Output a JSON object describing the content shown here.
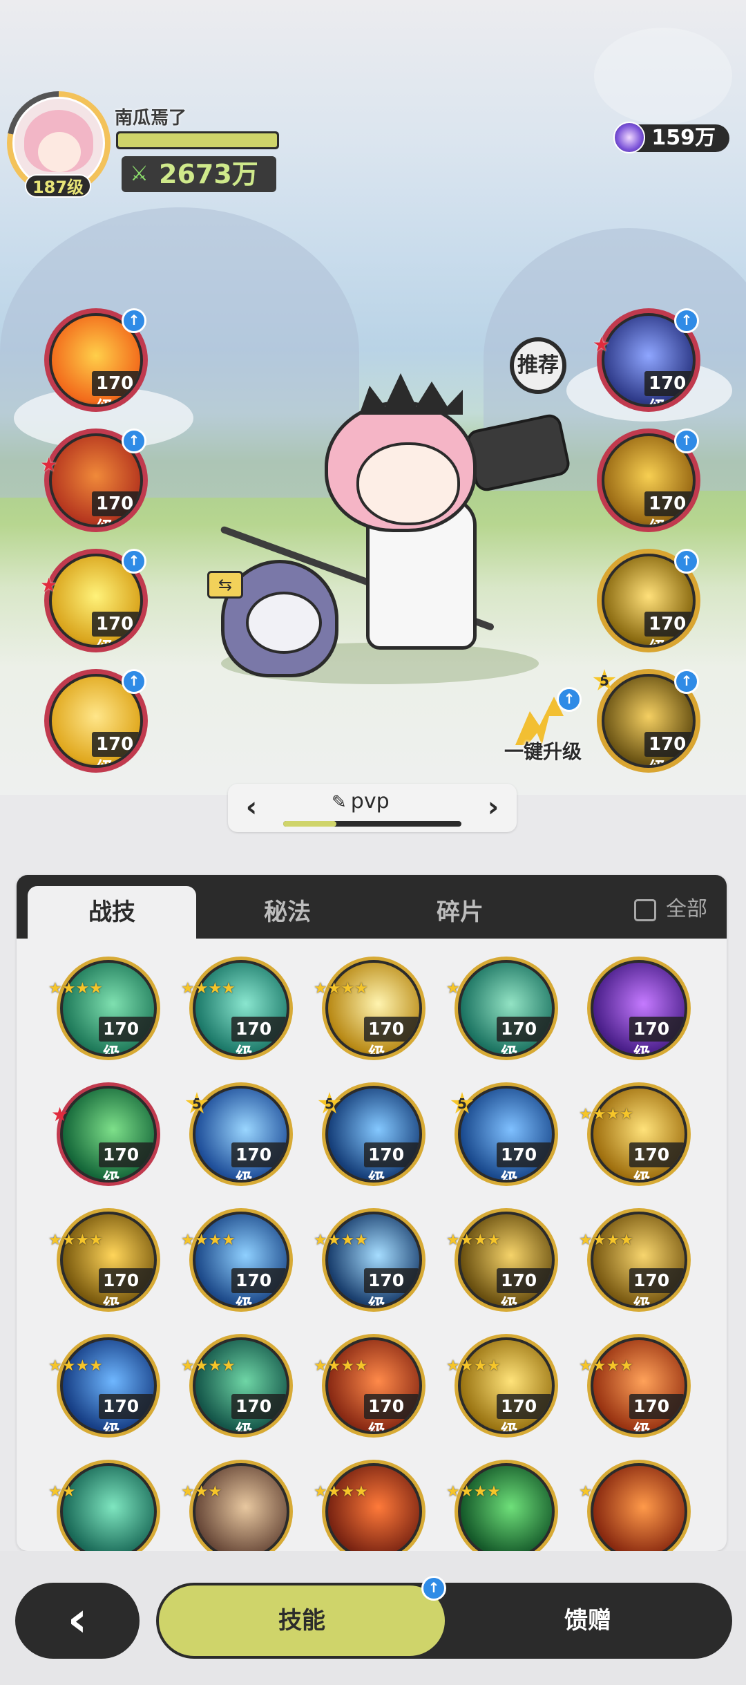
{
  "player": {
    "name": "南瓜焉了",
    "level": "187级",
    "power": "2673万",
    "currency": "159万"
  },
  "left_slots": [
    {
      "level": "170级",
      "colors": [
        "#f26a1b",
        "#ffcf4a"
      ],
      "ring": "red",
      "red_star": false
    },
    {
      "level": "170级",
      "colors": [
        "#b6371f",
        "#f08a3a"
      ],
      "ring": "red",
      "red_star": true
    },
    {
      "level": "170级",
      "colors": [
        "#d9a41c",
        "#fff27a"
      ],
      "ring": "red",
      "red_star": true
    },
    {
      "level": "170级",
      "colors": [
        "#e0a81e",
        "#ffe68a"
      ],
      "ring": "red",
      "red_star": false
    }
  ],
  "right_slots": [
    {
      "level": "170级",
      "colors": [
        "#2f3b8a",
        "#8fa6ff"
      ],
      "ring": "red",
      "red_star": true
    },
    {
      "level": "170级",
      "colors": [
        "#9a6a14",
        "#f7cf52"
      ],
      "ring": "red",
      "red_star": false
    },
    {
      "level": "170级",
      "colors": [
        "#8a6a10",
        "#ffe07a"
      ],
      "ring": "gold",
      "red_star": false
    },
    {
      "level": "170级",
      "colors": [
        "#6b5414",
        "#f4cf62"
      ],
      "ring": "gold",
      "red_star": false
    }
  ],
  "recommend_label": "推荐",
  "one_key_upgrade": {
    "label": "一键升级",
    "badge": "5"
  },
  "preset": {
    "label": "pvp",
    "progress": 0.3
  },
  "panel": {
    "tabs": [
      {
        "label": "战技",
        "active": true
      },
      {
        "label": "秘法",
        "active": false
      },
      {
        "label": "碎片",
        "active": false
      }
    ],
    "all_label": "全部",
    "skills": [
      {
        "level": "170级",
        "colors": [
          "#1f7a5a",
          "#7fe0b0"
        ],
        "stars": 4,
        "five": false,
        "red": false
      },
      {
        "level": "170级",
        "colors": [
          "#1d7a6a",
          "#8ae6cf"
        ],
        "stars": 4,
        "five": false,
        "red": false
      },
      {
        "level": "170级",
        "colors": [
          "#b98a16",
          "#fff4b0"
        ],
        "stars": 4,
        "five": false,
        "red": false
      },
      {
        "level": "170级",
        "colors": [
          "#1c7462",
          "#93e3c4"
        ],
        "stars": 1,
        "five": false,
        "red": false
      },
      {
        "level": "170级",
        "colors": [
          "#4a1f8a",
          "#c57aff"
        ],
        "stars": 0,
        "five": false,
        "red": false
      },
      {
        "level": "170级",
        "colors": [
          "#15683a",
          "#7ee08a"
        ],
        "stars": 0,
        "five": false,
        "red": true
      },
      {
        "level": "170级",
        "colors": [
          "#1f4f9a",
          "#9ad6ff"
        ],
        "stars": 0,
        "five": true,
        "red": false
      },
      {
        "level": "170级",
        "colors": [
          "#163f7a",
          "#84c8ff"
        ],
        "stars": 0,
        "five": true,
        "red": false
      },
      {
        "level": "170级",
        "colors": [
          "#1a4a8e",
          "#7fc0ff"
        ],
        "stars": 0,
        "five": true,
        "red": false
      },
      {
        "level": "170级",
        "colors": [
          "#a0700f",
          "#ffe27a"
        ],
        "stars": 4,
        "five": false,
        "red": false
      },
      {
        "level": "170级",
        "colors": [
          "#7a5a0e",
          "#ffd55a"
        ],
        "stars": 4,
        "five": false,
        "red": false
      },
      {
        "level": "170级",
        "colors": [
          "#1d4a8a",
          "#8fd0ff"
        ],
        "stars": 4,
        "five": false,
        "red": false
      },
      {
        "level": "170级",
        "colors": [
          "#1a3f6e",
          "#a6ddff"
        ],
        "stars": 4,
        "five": false,
        "red": false
      },
      {
        "level": "170级",
        "colors": [
          "#6a5010",
          "#f5d36a"
        ],
        "stars": 4,
        "five": false,
        "red": false
      },
      {
        "level": "170级",
        "colors": [
          "#7a5a12",
          "#f7d56e"
        ],
        "stars": 4,
        "five": false,
        "red": false
      },
      {
        "level": "170级",
        "colors": [
          "#173f86",
          "#6fb7ff"
        ],
        "stars": 4,
        "five": false,
        "red": false
      },
      {
        "level": "170级",
        "colors": [
          "#15574a",
          "#6fd6a6"
        ],
        "stars": 4,
        "five": false,
        "red": false
      },
      {
        "level": "170级",
        "colors": [
          "#8a2a14",
          "#ff8a4a"
        ],
        "stars": 4,
        "five": false,
        "red": false
      },
      {
        "level": "170级",
        "colors": [
          "#9a7412",
          "#ffe37a"
        ],
        "stars": 4,
        "five": false,
        "red": false
      },
      {
        "level": "170级",
        "colors": [
          "#9a3412",
          "#ffa25a"
        ],
        "stars": 4,
        "five": false,
        "red": false
      },
      {
        "level": "",
        "colors": [
          "#1a6a58",
          "#7fe6c0"
        ],
        "stars": 2,
        "five": false,
        "red": false
      },
      {
        "level": "",
        "colors": [
          "#6a4a3a",
          "#e8c8a0"
        ],
        "stars": 3,
        "five": false,
        "red": false
      },
      {
        "level": "",
        "colors": [
          "#7a2412",
          "#ff7a3a"
        ],
        "stars": 4,
        "five": false,
        "red": false
      },
      {
        "level": "",
        "colors": [
          "#155a2a",
          "#6fe07a"
        ],
        "stars": 4,
        "five": false,
        "red": false
      },
      {
        "level": "",
        "colors": [
          "#8a2a10",
          "#ff9a4a"
        ],
        "stars": 1,
        "five": false,
        "red": false
      }
    ]
  },
  "bottom": {
    "back_icon": "back-arrow-icon",
    "tab_active": "技能",
    "tab_other": "馈赠"
  }
}
